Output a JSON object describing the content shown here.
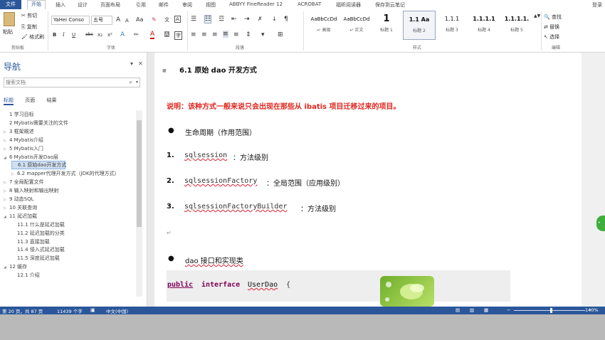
{
  "menubar": {
    "file": "文件",
    "tabs": [
      "开始",
      "插入",
      "设计",
      "页面布局",
      "引用",
      "邮件",
      "审阅",
      "视图",
      "ABBYY FineReader 12",
      "ACROBAT",
      "福昕阅读器",
      "保存到云笔记"
    ],
    "login": "登录"
  },
  "ribbon": {
    "clipboard": {
      "paste": "粘贴",
      "cut": "剪切",
      "copy": "复制",
      "format_painter": "格式刷",
      "label": "剪贴板"
    },
    "font": {
      "name": "YaHei Conso",
      "size": "五号",
      "grow": "A",
      "shrink": "A",
      "case": "Aa",
      "clear": "A",
      "label": "字体",
      "bold": "B",
      "italic": "I",
      "underline": "U",
      "strike": "abc",
      "sub": "x₂",
      "sup": "x²"
    },
    "paragraph": {
      "label": "段落"
    },
    "styles": {
      "items": [
        {
          "sample": "AaBbCcDd",
          "name": "↵ 高级"
        },
        {
          "sample": "AaBbCcDd",
          "name": "↵ 正文"
        },
        {
          "sample": "1",
          "name": "标题 1"
        },
        {
          "sample": "1.1 Aa",
          "name": "标题 2"
        },
        {
          "sample": "1.1.1",
          "name": "标题 3"
        },
        {
          "sample": "1.1.1.1",
          "name": "标题 4"
        },
        {
          "sample": "1.1.1.1.",
          "name": "标题 5"
        }
      ],
      "label": "样式"
    },
    "editing": {
      "find": "查找",
      "replace": "替换",
      "select": "选择",
      "label": "编辑"
    }
  },
  "nav": {
    "title": "导航",
    "search_placeholder": "搜索文档",
    "tabs": [
      "标题",
      "页面",
      "结果"
    ],
    "outline": [
      {
        "label": "1 学习目标",
        "level": 0,
        "twisty": ""
      },
      {
        "label": "2 Mybatis需要关注的文件",
        "level": 0,
        "twisty": ""
      },
      {
        "label": "3 框架概述",
        "level": 0,
        "twisty": "▷"
      },
      {
        "label": "4 Mybatis介绍",
        "level": 0,
        "twisty": "▷"
      },
      {
        "label": "5 Mybatis入门",
        "level": 0,
        "twisty": "▷"
      },
      {
        "label": "6 Mybatis开发Dao层",
        "level": 0,
        "twisty": "◢"
      },
      {
        "label": "6.1 原始dao开发方式",
        "level": 1,
        "twisty": ""
      },
      {
        "label": "6.2 mapper代理开发方式（JDK的代理方式）",
        "level": 1,
        "twisty": "▷"
      },
      {
        "label": "7 全局配置文件",
        "level": 0,
        "twisty": "▷"
      },
      {
        "label": "8 输入映射和输出映射",
        "level": 0,
        "twisty": "▷"
      },
      {
        "label": "9 动态SQL",
        "level": 0,
        "twisty": "▷"
      },
      {
        "label": "10 关联查询",
        "level": 0,
        "twisty": "▷"
      },
      {
        "label": "11 延迟加载",
        "level": 0,
        "twisty": "◢"
      },
      {
        "label": "11.1 什么是延迟加载",
        "level": 1,
        "twisty": ""
      },
      {
        "label": "11.2 延迟加载的分类",
        "level": 1,
        "twisty": ""
      },
      {
        "label": "11.3 直接加载",
        "level": 1,
        "twisty": ""
      },
      {
        "label": "11.4 侵入式延迟加载",
        "level": 1,
        "twisty": ""
      },
      {
        "label": "11.5 深度延迟加载",
        "level": 1,
        "twisty": ""
      },
      {
        "label": "12 缓存",
        "level": 0,
        "twisty": "◢"
      },
      {
        "label": "12.1 介绍",
        "level": 1,
        "twisty": ""
      }
    ]
  },
  "doc": {
    "heading": "6.1   原始 dao 开发方式",
    "note": "说明：该种方式一般来说只会出现在那些从 ibatis 项目迁移过来的项目。",
    "bullet1": "生命周期（作用范围）",
    "items": [
      {
        "num": "1.",
        "code": "sqlsession",
        "text": "：方法级别"
      },
      {
        "num": "2.",
        "code": "sqlsessionFactory",
        "text": "：全局范围（应用级别）"
      },
      {
        "num": "3.",
        "code": "sqlsessionFactoryBuilder",
        "text": "：方法级别"
      }
    ],
    "bullet2": "dao 接口和实现类",
    "code_line": {
      "kw1": "public",
      "kw2": "interface",
      "name": "UserDao",
      "brace": "{"
    }
  },
  "status": {
    "page": "第 20 页，共 87 页",
    "words": "11439 个字",
    "lang": "中文(中国)",
    "zoom": "140%",
    "zoom_level": 0.52
  }
}
